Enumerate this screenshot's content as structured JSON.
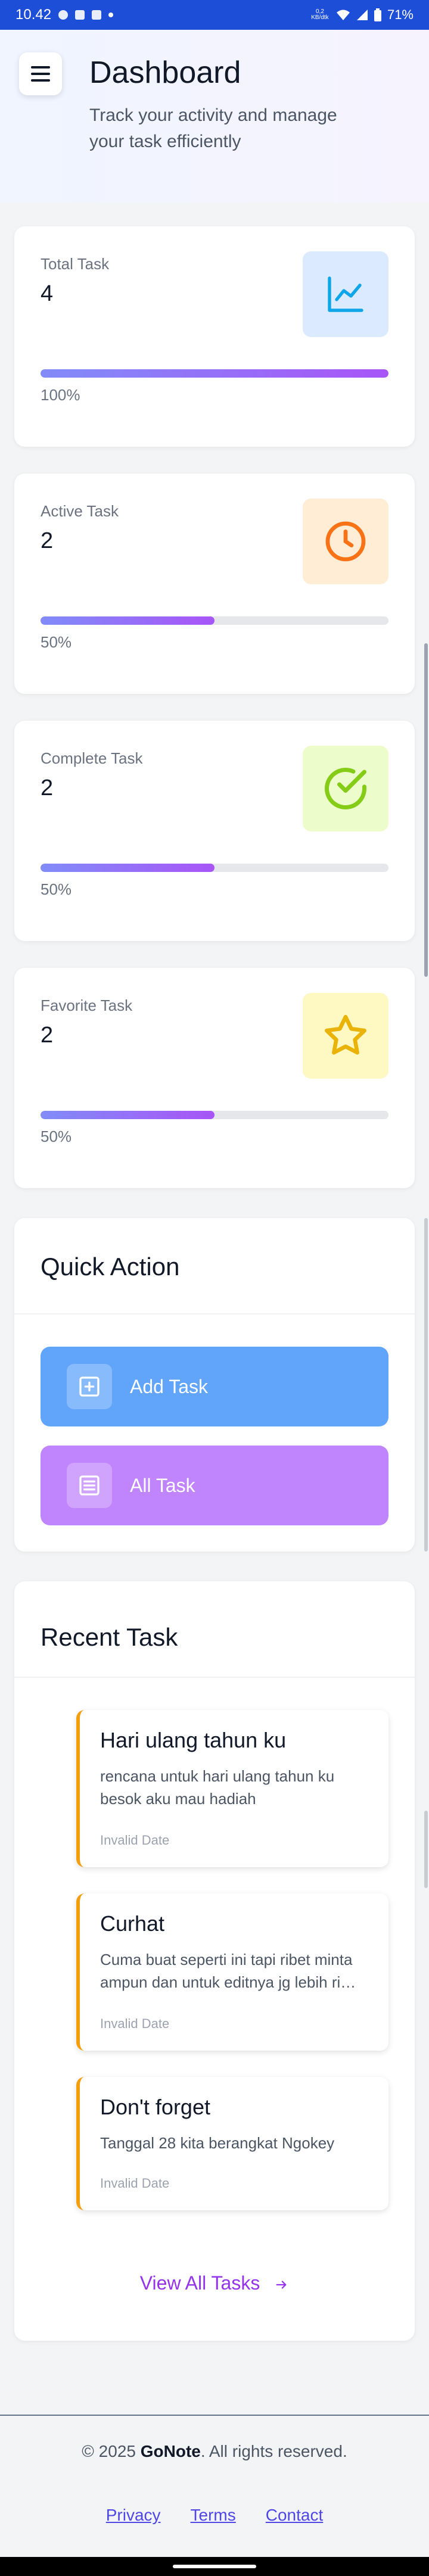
{
  "statusbar": {
    "time": "10.42",
    "net_speed": "0,2 KB/dtk",
    "battery": "71%"
  },
  "header": {
    "title": "Dashboard",
    "subtitle": "Track your activity and manage your task efficiently"
  },
  "stats": [
    {
      "label": "Total Task",
      "value": "4",
      "progress_label": "100%",
      "progress": 1.0,
      "icon": "line-chart-icon",
      "icon_bg": "#dbeafe",
      "icon_color": "#0ea5e9"
    },
    {
      "label": "Active Task",
      "value": "2",
      "progress_label": "50%",
      "progress": 0.5,
      "icon": "clock-icon",
      "icon_bg": "#ffedd5",
      "icon_color": "#f97316"
    },
    {
      "label": "Complete Task",
      "value": "2",
      "progress_label": "50%",
      "progress": 0.5,
      "icon": "check-circle-icon",
      "icon_bg": "#ecfccb",
      "icon_color": "#84cc16"
    },
    {
      "label": "Favorite Task",
      "value": "2",
      "progress_label": "50%",
      "progress": 0.5,
      "icon": "star-icon",
      "icon_bg": "#fef9c3",
      "icon_color": "#eab308"
    }
  ],
  "quick_action": {
    "title": "Quick Action",
    "add_label": "Add Task",
    "all_label": "All Task",
    "add_color": "#60a5fa",
    "all_color": "#c084fc"
  },
  "recent": {
    "title": "Recent Task",
    "tasks": [
      {
        "title": "Hari ulang tahun ku",
        "desc": "rencana untuk hari ulang tahun ku besok aku mau hadiah",
        "date": "Invalid Date"
      },
      {
        "title": "Curhat",
        "desc": "Cuma buat seperti ini tapi ribet minta ampun dan untuk editnya jg lebih ribet...",
        "date": "Invalid Date"
      },
      {
        "title": "Don't forget",
        "desc": "Tanggal 28 kita berangkat Ngokey",
        "date": "Invalid Date"
      }
    ],
    "view_all": "View All Tasks"
  },
  "footer": {
    "copyright_prefix": "© 2025 ",
    "brand": "GoNote",
    "copyright_suffix": ". All rights reserved.",
    "links": [
      "Privacy",
      "Terms",
      "Contact"
    ]
  }
}
